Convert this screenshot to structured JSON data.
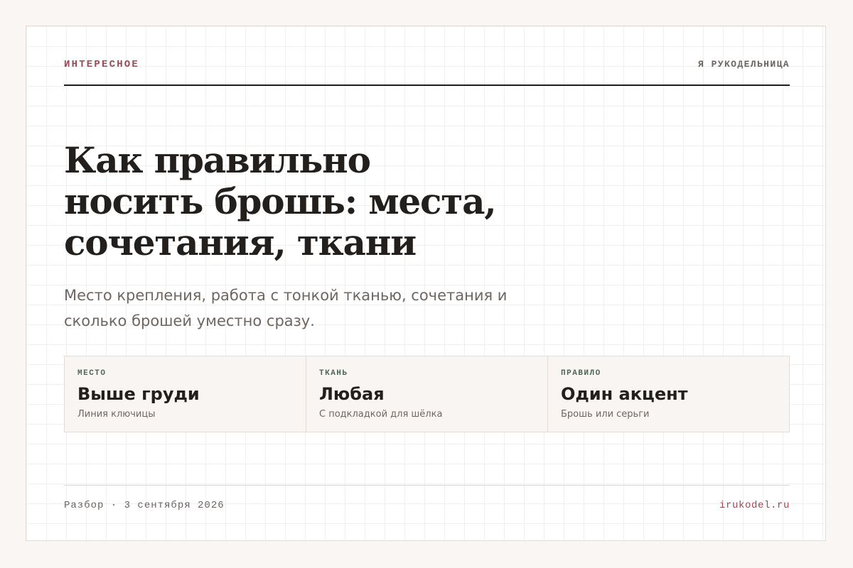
{
  "header": {
    "kicker": "ИНТЕРЕСНОЕ",
    "brand": "Я РУКОДЕЛЬНИЦА"
  },
  "article": {
    "title": "Как правильно носить брошь: места, сочетания, ткани",
    "subtitle": "Место крепления, работа с тонкой тканью, сочетания и сколько брошей уместно сразу."
  },
  "facts": [
    {
      "label": "МЕСТО",
      "value": "Выше груди",
      "note": "Линия ключицы"
    },
    {
      "label": "ТКАНЬ",
      "value": "Любая",
      "note": "С подкладкой для шёлка"
    },
    {
      "label": "ПРАВИЛО",
      "value": "Один акцент",
      "note": "Брошь или серьги"
    }
  ],
  "footer": {
    "meta": "Разбор · 3 сентября 2026",
    "site": "irukodel.ru"
  },
  "colors": {
    "accent": "#9a4a56",
    "label_green": "#4e6656",
    "text": "#231f1c",
    "muted": "#6e6661",
    "background": "#faf6f3"
  }
}
